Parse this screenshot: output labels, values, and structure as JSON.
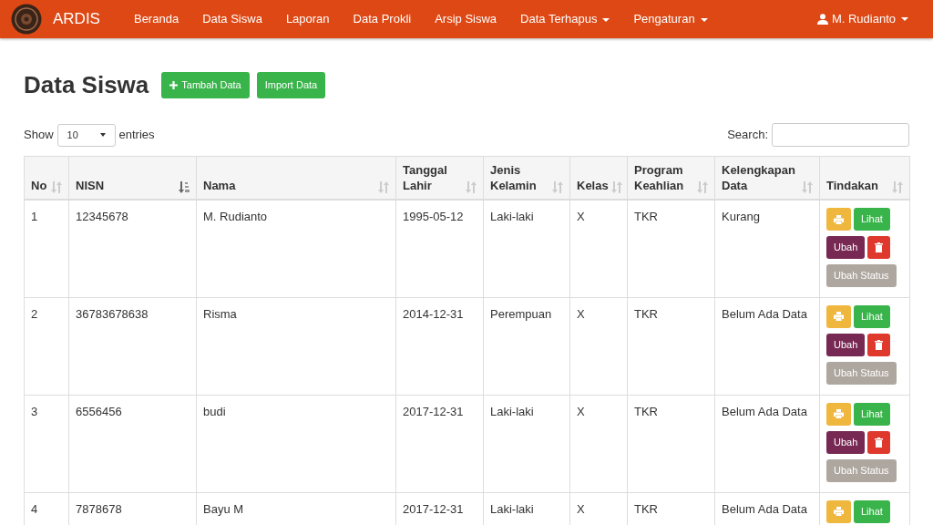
{
  "navbar": {
    "brand": "ARDIS",
    "items": [
      {
        "label": "Beranda",
        "dropdown": false
      },
      {
        "label": "Data Siswa",
        "dropdown": false
      },
      {
        "label": "Laporan",
        "dropdown": false
      },
      {
        "label": "Data Prokli",
        "dropdown": false
      },
      {
        "label": "Arsip Siswa",
        "dropdown": false
      },
      {
        "label": "Data Terhapus",
        "dropdown": true
      },
      {
        "label": "Pengaturan",
        "dropdown": true
      }
    ],
    "user": "M. Rudianto"
  },
  "page": {
    "title": "Data Siswa",
    "buttons": [
      {
        "label": "Tambah Data",
        "kind": "add"
      },
      {
        "label": "Import Data",
        "kind": "plain"
      }
    ]
  },
  "length_menu": {
    "before": "Show",
    "value": "10",
    "after": "entries"
  },
  "search": {
    "label": "Search:"
  },
  "table": {
    "columns": [
      {
        "label": "No",
        "sorted": false
      },
      {
        "label": "NISN",
        "sorted": true
      },
      {
        "label": "Nama",
        "sorted": false
      },
      {
        "label": "Tanggal Lahir",
        "sorted": false
      },
      {
        "label": "Jenis Kelamin",
        "sorted": false
      },
      {
        "label": "Kelas",
        "sorted": false
      },
      {
        "label": "Program Keahlian",
        "sorted": false
      },
      {
        "label": "Kelengkapan Data",
        "sorted": false
      },
      {
        "label": "Tindakan",
        "sorted": false
      }
    ],
    "rows": [
      {
        "cells": [
          "1",
          "12345678",
          "M. Rudianto",
          "1995-05-12",
          "Laki-laki",
          "X",
          "TKR",
          "Kurang"
        ],
        "actions": [
          {
            "kind": "print"
          },
          {
            "kind": "view",
            "label": "Lihat"
          },
          {
            "kind": "edit",
            "label": "Ubah"
          },
          {
            "kind": "delete"
          },
          {
            "kind": "status",
            "label": "Ubah Status"
          }
        ]
      },
      {
        "cells": [
          "2",
          "36783678638",
          "Risma",
          "2014-12-31",
          "Perempuan",
          "X",
          "TKR",
          "Belum Ada Data"
        ],
        "actions": [
          {
            "kind": "print"
          },
          {
            "kind": "view",
            "label": "Lihat"
          },
          {
            "kind": "edit",
            "label": "Ubah"
          },
          {
            "kind": "delete"
          },
          {
            "kind": "status",
            "label": "Ubah Status"
          }
        ]
      },
      {
        "cells": [
          "3",
          "6556456",
          "budi",
          "2017-12-31",
          "Laki-laki",
          "X",
          "TKR",
          "Belum Ada Data"
        ],
        "actions": [
          {
            "kind": "print"
          },
          {
            "kind": "view",
            "label": "Lihat"
          },
          {
            "kind": "edit",
            "label": "Ubah"
          },
          {
            "kind": "delete"
          },
          {
            "kind": "status",
            "label": "Ubah Status"
          }
        ]
      },
      {
        "cells": [
          "4",
          "7878678",
          "Bayu M",
          "2017-12-31",
          "Laki-laki",
          "X",
          "TKR",
          "Belum Ada Data"
        ],
        "actions": [
          {
            "kind": "print"
          },
          {
            "kind": "view",
            "label": "Lihat"
          }
        ]
      }
    ]
  }
}
